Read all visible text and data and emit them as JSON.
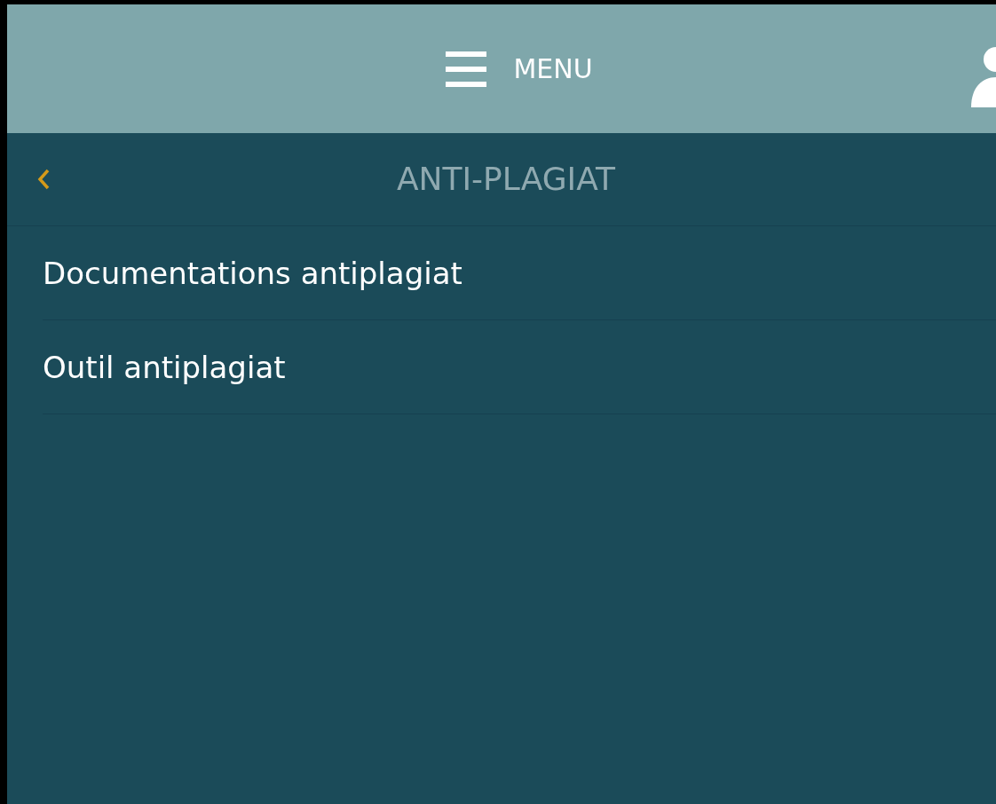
{
  "header": {
    "menu_label": "MENU"
  },
  "panel": {
    "title": "ANTI-PLAGIAT",
    "items": [
      {
        "label": "Documentations antiplagiat"
      },
      {
        "label": "Outil antiplagiat"
      }
    ]
  }
}
